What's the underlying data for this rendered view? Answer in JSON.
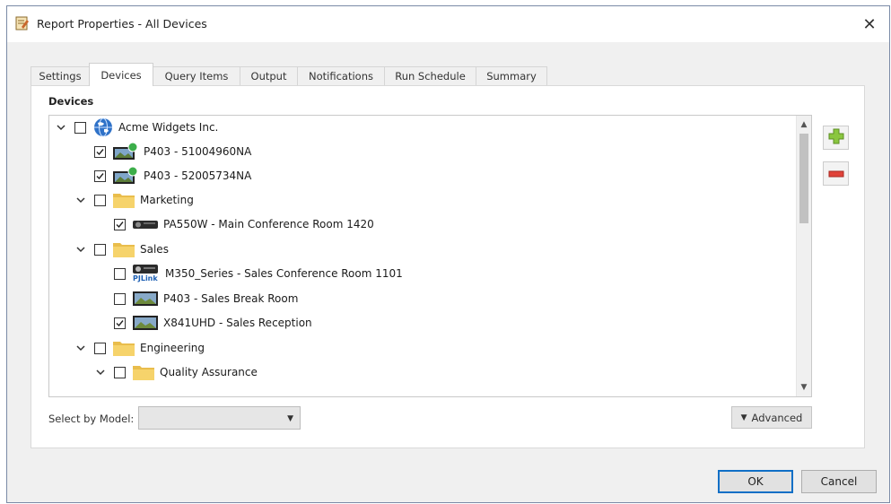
{
  "window": {
    "title": "Report Properties - All Devices"
  },
  "tabs": [
    {
      "label": "Settings"
    },
    {
      "label": "Devices"
    },
    {
      "label": "Query Items"
    },
    {
      "label": "Output"
    },
    {
      "label": "Notifications"
    },
    {
      "label": "Run Schedule"
    },
    {
      "label": "Summary"
    }
  ],
  "active_tab": "Devices",
  "devices_section": {
    "label": "Devices"
  },
  "tree": [
    {
      "label": "Acme Widgets Inc.",
      "checked": false,
      "expanded": true,
      "icon": "globe-icon"
    },
    {
      "label": "P403 - 51004960NA",
      "checked": true,
      "icon": "projector-online-icon"
    },
    {
      "label": "P403 - 52005734NA",
      "checked": true,
      "icon": "projector-online-icon"
    },
    {
      "label": "Marketing",
      "checked": false,
      "expanded": true,
      "icon": "folder-icon"
    },
    {
      "label": "PA550W - Main Conference Room 1420",
      "checked": true,
      "icon": "projector-icon"
    },
    {
      "label": "Sales",
      "checked": false,
      "expanded": true,
      "icon": "folder-icon"
    },
    {
      "label": "M350_Series - Sales Conference Room 1101",
      "checked": false,
      "icon": "pjlink-projector-icon",
      "icon_text": "PJLink"
    },
    {
      "label": "P403 - Sales Break Room",
      "checked": false,
      "icon": "projector-image-icon"
    },
    {
      "label": "X841UHD - Sales Reception",
      "checked": true,
      "icon": "projector-image-icon"
    },
    {
      "label": "Engineering",
      "checked": false,
      "expanded": true,
      "icon": "folder-icon"
    },
    {
      "label": "Quality Assurance",
      "checked": false,
      "expanded": true,
      "icon": "folder-icon"
    }
  ],
  "select_by_model": {
    "label": "Select by Model:",
    "value": ""
  },
  "advanced_button": {
    "label": "Advanced"
  },
  "buttons": {
    "ok": "OK",
    "cancel": "Cancel"
  },
  "colors": {
    "add": "#8ac63f",
    "remove": "#e0433a",
    "folder": "#f6d36b",
    "accent": "#0f6fc6"
  }
}
